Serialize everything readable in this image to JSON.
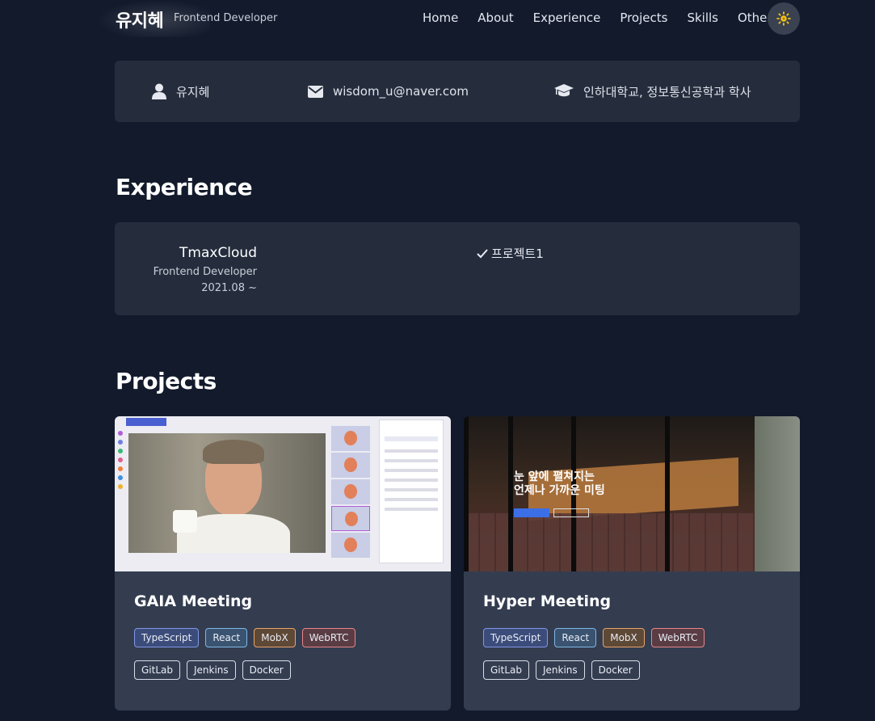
{
  "header": {
    "brand_name": "유지혜",
    "brand_role": "Frontend Developer",
    "nav": [
      "Home",
      "About",
      "Experience",
      "Projects",
      "Skills",
      "Other"
    ]
  },
  "about": {
    "name": "유지혜",
    "email": "wisdom_u@naver.com",
    "education": "인하대학교, 정보통신공학과 학사"
  },
  "experience": {
    "title": "Experience",
    "items": [
      {
        "company": "TmaxCloud",
        "role": "Frontend Developer",
        "period": "2021.08 ~",
        "project": "프로젝트1"
      }
    ]
  },
  "projects": {
    "title": "Projects",
    "items": [
      {
        "name": "GAIA Meeting",
        "tags": [
          "TypeScript",
          "React",
          "MobX",
          "WebRTC"
        ],
        "tools": [
          "GitLab",
          "Jenkins",
          "Docker"
        ]
      },
      {
        "name": "Hyper Meeting",
        "tags": [
          "TypeScript",
          "React",
          "MobX",
          "WebRTC"
        ],
        "tools": [
          "GitLab",
          "Jenkins",
          "Docker"
        ],
        "image_heading_line1": "눈 앞에 펼쳐지는",
        "image_heading_line2": "언제나 가까운 미팅"
      }
    ]
  },
  "colors": {
    "background": "#121a2c",
    "card": "#252d3d",
    "project_card": "#343d50",
    "theme_icon": "#f5c518"
  },
  "icons": {
    "theme_toggle": "sun-icon",
    "name": "user-icon",
    "email": "envelope-icon",
    "education": "graduation-cap-icon",
    "project_check": "check-icon"
  }
}
